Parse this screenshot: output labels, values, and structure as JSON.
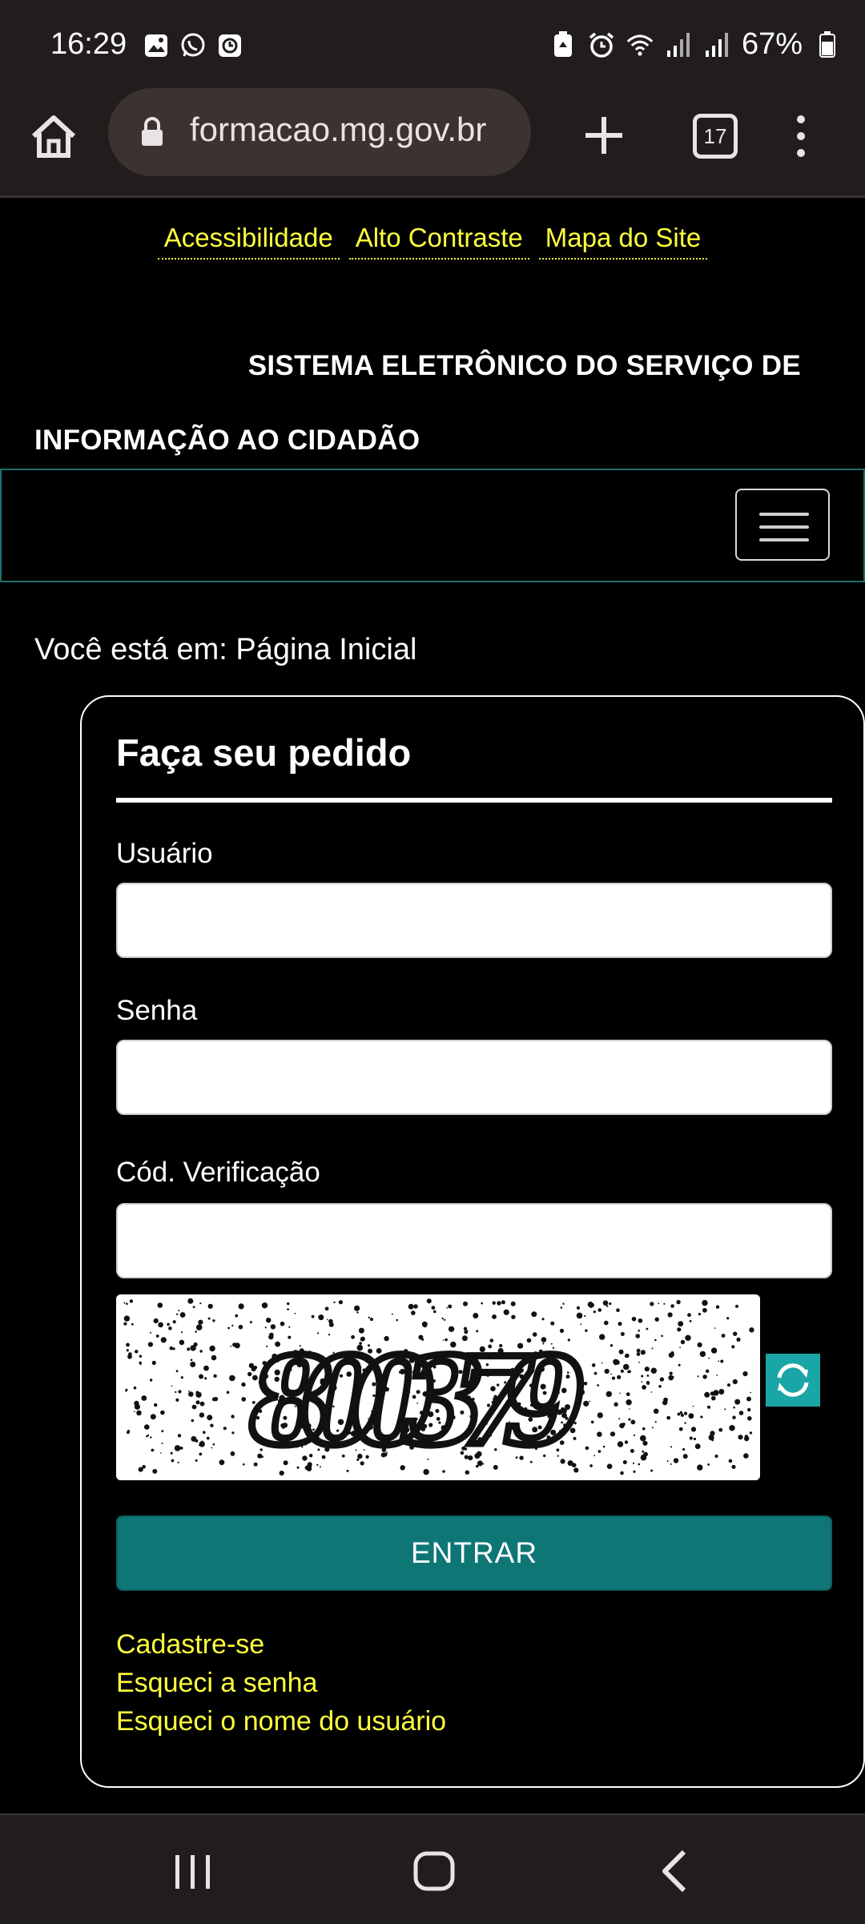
{
  "status_bar": {
    "time": "16:29",
    "battery": "67%",
    "left_icons": [
      "gallery-icon",
      "whatsapp-icon",
      "clock-app-icon"
    ],
    "right_icons": [
      "battery-saver-icon",
      "alarm-icon",
      "wifi-icon",
      "signal-icon",
      "signal-icon",
      "battery-icon"
    ]
  },
  "browser": {
    "url": "formacao.mg.gov.br",
    "tab_count": "17"
  },
  "accessibility_links": [
    "Acessibilidade",
    "Alto Contraste",
    "Mapa do Site"
  ],
  "site_title": {
    "line1": "SISTEMA ELETRÔNICO DO SERVIÇO DE",
    "line2": "INFORMAÇÃO AO CIDADÃO"
  },
  "breadcrumb": "Você está em: Página Inicial",
  "login": {
    "title": "Faça seu pedido",
    "username_label": "Usuário",
    "username_value": "",
    "password_label": "Senha",
    "password_value": "",
    "code_label": "Cód. Verificação",
    "code_value": "",
    "captcha_text": "800379",
    "submit_label": "ENTRAR",
    "links": [
      "Cadastre-se",
      "Esqueci a senha",
      "Esqueci o nome do usuário"
    ]
  },
  "colors": {
    "link_yellow": "#ffff3c",
    "teal": "#0f7676",
    "chrome": "#211d1c"
  }
}
